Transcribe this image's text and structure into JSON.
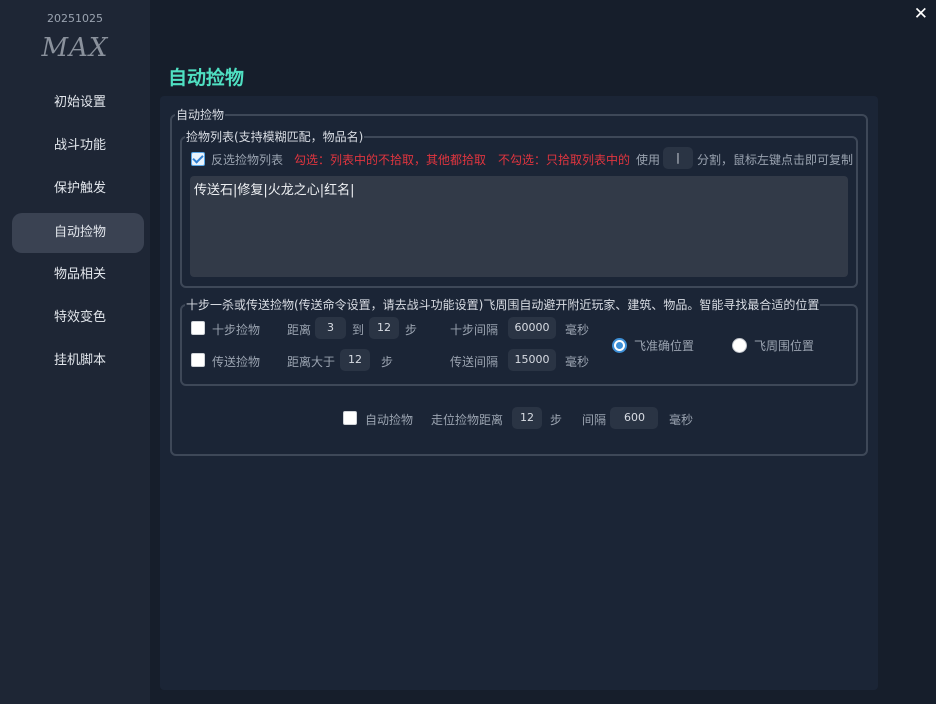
{
  "sidebar": {
    "version": "20251025",
    "logo": "MAX",
    "items": [
      {
        "label": "初始设置"
      },
      {
        "label": "战斗功能"
      },
      {
        "label": "保护触发"
      },
      {
        "label": "自动捡物"
      },
      {
        "label": "物品相关"
      },
      {
        "label": "特效变色"
      },
      {
        "label": "挂机脚本"
      }
    ],
    "active": "自动捡物"
  },
  "window": {
    "close_glyph": "✕"
  },
  "page": {
    "title": "自动捡物"
  },
  "group_main": {
    "legend": "自动捡物"
  },
  "pickup_list": {
    "legend": "捡物列表(支持模糊匹配，物品名)",
    "invert_checkbox": {
      "label": "反选捡物列表",
      "checked": true
    },
    "hint_checked": "勾选：列表中的不拾取，其他都拾取",
    "hint_unchecked": "不勾选：只拾取列表中的",
    "use_label": "使用",
    "separator": "|",
    "hint_tail": "分割，鼠标左键点击即可复制",
    "items_text": "传送石|修复|火龙之心|红名|"
  },
  "teleport_pickup": {
    "legend": "十步一杀或传送捡物(传送命令设置，请去战斗功能设置)飞周围自动避开附近玩家、建筑、物品。智能寻找最合适的位置",
    "ten_step": {
      "label": "十步捡物",
      "checked": false,
      "distance_label": "距离",
      "distance_min": "3",
      "to_label": "到",
      "distance_max": "12",
      "step_unit": "步",
      "interval_label": "十步间隔",
      "interval": "60000",
      "interval_unit": "毫秒"
    },
    "teleport": {
      "label": "传送捡物",
      "checked": false,
      "distance_label": "距离大于",
      "distance": "12",
      "step_unit": "步",
      "interval_label": "传送间隔",
      "interval": "15000",
      "interval_unit": "毫秒"
    },
    "radio_precise": {
      "label": "飞准确位置",
      "selected": true
    },
    "radio_around": {
      "label": "飞周围位置",
      "selected": false
    }
  },
  "auto_pickup": {
    "label": "自动捡物",
    "checked": false,
    "walk_distance_label": "走位捡物距离",
    "walk_distance": "12",
    "step_unit": "步",
    "interval_label": "间隔",
    "interval": "600",
    "interval_unit": "毫秒"
  },
  "colors": {
    "accent_title": "#4fe0c2",
    "warning_red": "#e0353f",
    "sidebar_active": "#3a4252",
    "radio_blue": "#3d8fd6"
  }
}
